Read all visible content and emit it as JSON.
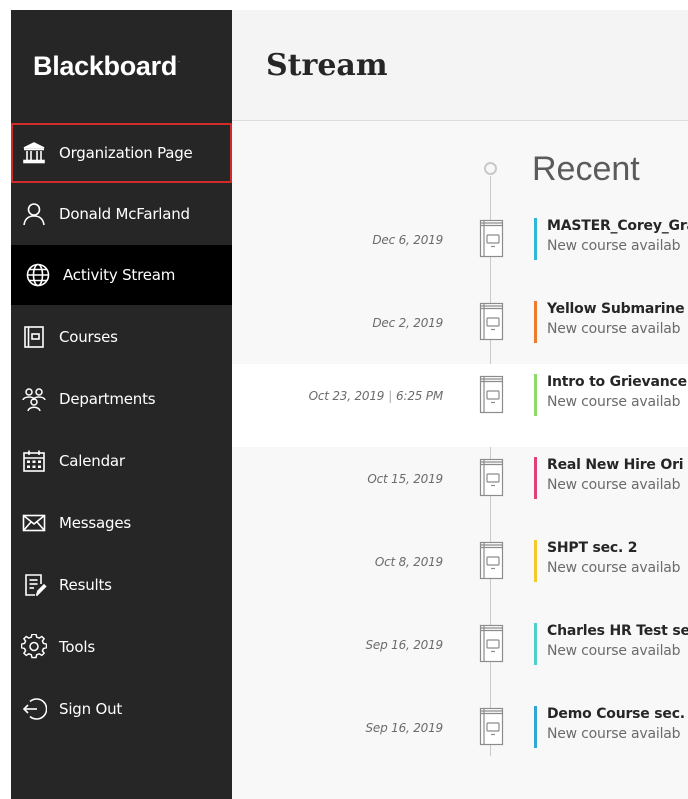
{
  "brand": {
    "name": "Blackboard",
    "mark": "."
  },
  "sidebar": {
    "items": [
      {
        "label": "Organization Page",
        "icon": "institution-icon"
      },
      {
        "label": "Donald McFarland",
        "icon": "user-icon"
      },
      {
        "label": "Activity Stream",
        "icon": "globe-icon"
      },
      {
        "label": "Courses",
        "icon": "courses-icon"
      },
      {
        "label": "Departments",
        "icon": "departments-icon"
      },
      {
        "label": "Calendar",
        "icon": "calendar-icon"
      },
      {
        "label": "Messages",
        "icon": "envelope-icon"
      },
      {
        "label": "Results",
        "icon": "results-icon"
      },
      {
        "label": "Tools",
        "icon": "gear-icon"
      },
      {
        "label": "Sign Out",
        "icon": "sign-out-icon"
      }
    ]
  },
  "main": {
    "title": "Stream",
    "section": "Recent",
    "entries": [
      {
        "date": "Dec 6, 2019",
        "time": "",
        "title": "MASTER_Corey_Gra",
        "subtitle": "New course availab",
        "accent": "#2fb8d6"
      },
      {
        "date": "Dec 2, 2019",
        "time": "",
        "title": "Yellow Submarine",
        "subtitle": "New course availab",
        "accent": "#ef7a2e"
      },
      {
        "date": "Oct 23, 2019",
        "time": "6:25 PM",
        "title": "Intro to Grievance",
        "subtitle": "New course availab",
        "accent": "#8fd96a"
      },
      {
        "date": "Oct 15, 2019",
        "time": "",
        "title": "Real New Hire Ori",
        "subtitle": "New course availab",
        "accent": "#e0407a"
      },
      {
        "date": "Oct 8, 2019",
        "time": "",
        "title": "SHPT sec. 2",
        "subtitle": "New course availab",
        "accent": "#f4c92b"
      },
      {
        "date": "Sep 16, 2019",
        "time": "",
        "title": "Charles HR Test se",
        "subtitle": "New course availab",
        "accent": "#4ed0c8"
      },
      {
        "date": "Sep 16, 2019",
        "time": "",
        "title": "Demo Course sec.",
        "subtitle": "New course availab",
        "accent": "#2fa8d6"
      }
    ]
  }
}
